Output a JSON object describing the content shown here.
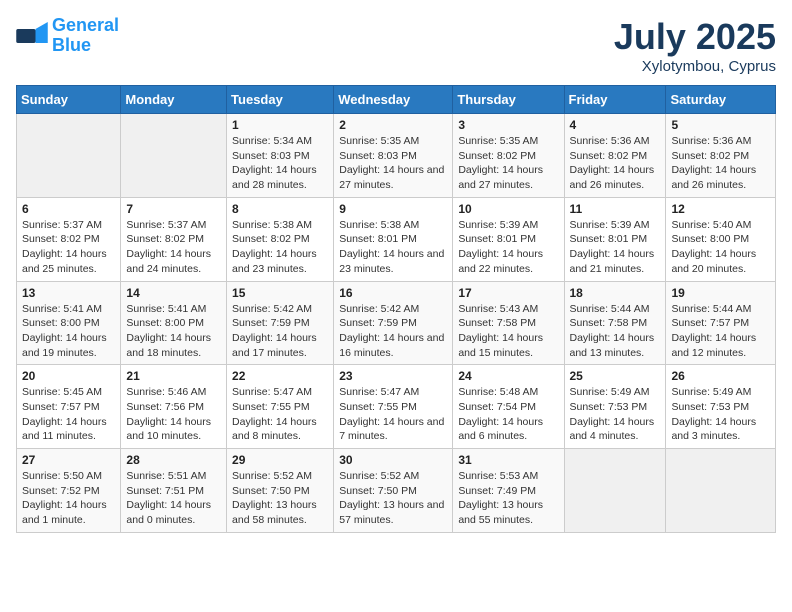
{
  "header": {
    "logo_line1": "General",
    "logo_line2": "Blue",
    "month": "July 2025",
    "location": "Xylotymbou, Cyprus"
  },
  "weekdays": [
    "Sunday",
    "Monday",
    "Tuesday",
    "Wednesday",
    "Thursday",
    "Friday",
    "Saturday"
  ],
  "weeks": [
    [
      {
        "day": "",
        "empty": true
      },
      {
        "day": "",
        "empty": true
      },
      {
        "day": "1",
        "sunrise": "Sunrise: 5:34 AM",
        "sunset": "Sunset: 8:03 PM",
        "daylight": "Daylight: 14 hours and 28 minutes."
      },
      {
        "day": "2",
        "sunrise": "Sunrise: 5:35 AM",
        "sunset": "Sunset: 8:03 PM",
        "daylight": "Daylight: 14 hours and 27 minutes."
      },
      {
        "day": "3",
        "sunrise": "Sunrise: 5:35 AM",
        "sunset": "Sunset: 8:02 PM",
        "daylight": "Daylight: 14 hours and 27 minutes."
      },
      {
        "day": "4",
        "sunrise": "Sunrise: 5:36 AM",
        "sunset": "Sunset: 8:02 PM",
        "daylight": "Daylight: 14 hours and 26 minutes."
      },
      {
        "day": "5",
        "sunrise": "Sunrise: 5:36 AM",
        "sunset": "Sunset: 8:02 PM",
        "daylight": "Daylight: 14 hours and 26 minutes."
      }
    ],
    [
      {
        "day": "6",
        "sunrise": "Sunrise: 5:37 AM",
        "sunset": "Sunset: 8:02 PM",
        "daylight": "Daylight: 14 hours and 25 minutes."
      },
      {
        "day": "7",
        "sunrise": "Sunrise: 5:37 AM",
        "sunset": "Sunset: 8:02 PM",
        "daylight": "Daylight: 14 hours and 24 minutes."
      },
      {
        "day": "8",
        "sunrise": "Sunrise: 5:38 AM",
        "sunset": "Sunset: 8:02 PM",
        "daylight": "Daylight: 14 hours and 23 minutes."
      },
      {
        "day": "9",
        "sunrise": "Sunrise: 5:38 AM",
        "sunset": "Sunset: 8:01 PM",
        "daylight": "Daylight: 14 hours and 23 minutes."
      },
      {
        "day": "10",
        "sunrise": "Sunrise: 5:39 AM",
        "sunset": "Sunset: 8:01 PM",
        "daylight": "Daylight: 14 hours and 22 minutes."
      },
      {
        "day": "11",
        "sunrise": "Sunrise: 5:39 AM",
        "sunset": "Sunset: 8:01 PM",
        "daylight": "Daylight: 14 hours and 21 minutes."
      },
      {
        "day": "12",
        "sunrise": "Sunrise: 5:40 AM",
        "sunset": "Sunset: 8:00 PM",
        "daylight": "Daylight: 14 hours and 20 minutes."
      }
    ],
    [
      {
        "day": "13",
        "sunrise": "Sunrise: 5:41 AM",
        "sunset": "Sunset: 8:00 PM",
        "daylight": "Daylight: 14 hours and 19 minutes."
      },
      {
        "day": "14",
        "sunrise": "Sunrise: 5:41 AM",
        "sunset": "Sunset: 8:00 PM",
        "daylight": "Daylight: 14 hours and 18 minutes."
      },
      {
        "day": "15",
        "sunrise": "Sunrise: 5:42 AM",
        "sunset": "Sunset: 7:59 PM",
        "daylight": "Daylight: 14 hours and 17 minutes."
      },
      {
        "day": "16",
        "sunrise": "Sunrise: 5:42 AM",
        "sunset": "Sunset: 7:59 PM",
        "daylight": "Daylight: 14 hours and 16 minutes."
      },
      {
        "day": "17",
        "sunrise": "Sunrise: 5:43 AM",
        "sunset": "Sunset: 7:58 PM",
        "daylight": "Daylight: 14 hours and 15 minutes."
      },
      {
        "day": "18",
        "sunrise": "Sunrise: 5:44 AM",
        "sunset": "Sunset: 7:58 PM",
        "daylight": "Daylight: 14 hours and 13 minutes."
      },
      {
        "day": "19",
        "sunrise": "Sunrise: 5:44 AM",
        "sunset": "Sunset: 7:57 PM",
        "daylight": "Daylight: 14 hours and 12 minutes."
      }
    ],
    [
      {
        "day": "20",
        "sunrise": "Sunrise: 5:45 AM",
        "sunset": "Sunset: 7:57 PM",
        "daylight": "Daylight: 14 hours and 11 minutes."
      },
      {
        "day": "21",
        "sunrise": "Sunrise: 5:46 AM",
        "sunset": "Sunset: 7:56 PM",
        "daylight": "Daylight: 14 hours and 10 minutes."
      },
      {
        "day": "22",
        "sunrise": "Sunrise: 5:47 AM",
        "sunset": "Sunset: 7:55 PM",
        "daylight": "Daylight: 14 hours and 8 minutes."
      },
      {
        "day": "23",
        "sunrise": "Sunrise: 5:47 AM",
        "sunset": "Sunset: 7:55 PM",
        "daylight": "Daylight: 14 hours and 7 minutes."
      },
      {
        "day": "24",
        "sunrise": "Sunrise: 5:48 AM",
        "sunset": "Sunset: 7:54 PM",
        "daylight": "Daylight: 14 hours and 6 minutes."
      },
      {
        "day": "25",
        "sunrise": "Sunrise: 5:49 AM",
        "sunset": "Sunset: 7:53 PM",
        "daylight": "Daylight: 14 hours and 4 minutes."
      },
      {
        "day": "26",
        "sunrise": "Sunrise: 5:49 AM",
        "sunset": "Sunset: 7:53 PM",
        "daylight": "Daylight: 14 hours and 3 minutes."
      }
    ],
    [
      {
        "day": "27",
        "sunrise": "Sunrise: 5:50 AM",
        "sunset": "Sunset: 7:52 PM",
        "daylight": "Daylight: 14 hours and 1 minute."
      },
      {
        "day": "28",
        "sunrise": "Sunrise: 5:51 AM",
        "sunset": "Sunset: 7:51 PM",
        "daylight": "Daylight: 14 hours and 0 minutes."
      },
      {
        "day": "29",
        "sunrise": "Sunrise: 5:52 AM",
        "sunset": "Sunset: 7:50 PM",
        "daylight": "Daylight: 13 hours and 58 minutes."
      },
      {
        "day": "30",
        "sunrise": "Sunrise: 5:52 AM",
        "sunset": "Sunset: 7:50 PM",
        "daylight": "Daylight: 13 hours and 57 minutes."
      },
      {
        "day": "31",
        "sunrise": "Sunrise: 5:53 AM",
        "sunset": "Sunset: 7:49 PM",
        "daylight": "Daylight: 13 hours and 55 minutes."
      },
      {
        "day": "",
        "empty": true
      },
      {
        "day": "",
        "empty": true
      }
    ]
  ]
}
